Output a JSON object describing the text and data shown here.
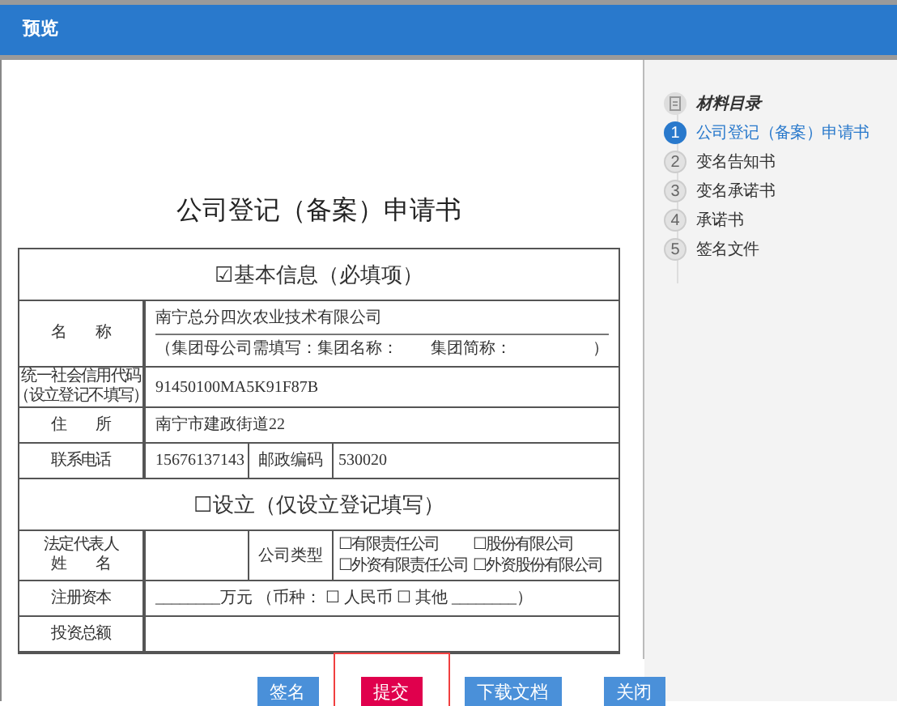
{
  "header": {
    "title": "预览"
  },
  "document": {
    "title": "公司登记（备案）申请书",
    "sections": [
      {
        "heading": "☑基本信息（必填项）",
        "rows": [
          {
            "kind": "name",
            "label": "名　　称",
            "value": "南宁总分四次农业技术有限公司",
            "note": "（集团母公司需填写：集团名称：",
            "note_2": "集团简称：",
            "note_end": "）"
          },
          {
            "kind": "wide",
            "label_lines": [
              "统一社会信用代码",
              "（设立登记不填写）"
            ],
            "value": "91450100MA5K91F87B"
          },
          {
            "kind": "wide",
            "label": "住　　所",
            "value": "南宁市建政街道22"
          },
          {
            "kind": "split",
            "label": "联系电话",
            "value": "15676137143",
            "label_2": "邮政编码",
            "value_2": "530020"
          }
        ]
      },
      {
        "heading": "☐设立（仅设立登记填写）",
        "rows": [
          {
            "kind": "options",
            "label_lines": [
              "法定代表人",
              "姓　　名"
            ],
            "value": "",
            "label_2": "公司类型",
            "options": [
              "☐有限责任公司",
              "☐股份有限公司",
              "☐外资有限责任公司",
              "☐外资股份有限公司"
            ]
          },
          {
            "kind": "wide",
            "label": "注册资本",
            "value": "________万元 （币种： ☐ 人民币 ☐ 其他 ________）"
          },
          {
            "kind": "wide",
            "label": "投资总额",
            "value": ""
          }
        ]
      }
    ]
  },
  "sidebar": {
    "title": "材料目录",
    "items": [
      {
        "number": "1",
        "label": "公司登记（备案）申请书",
        "selected": true
      },
      {
        "number": "2",
        "label": "变名告知书",
        "selected": false
      },
      {
        "number": "3",
        "label": "变名承诺书",
        "selected": false
      },
      {
        "number": "4",
        "label": "承诺书",
        "selected": false
      },
      {
        "number": "5",
        "label": "签名文件",
        "selected": false
      }
    ]
  },
  "buttons": [
    {
      "label": "签名",
      "kind": "primary",
      "highlighted": false
    },
    {
      "label": "提交",
      "kind": "danger",
      "highlighted": true
    },
    {
      "label": "下载文档",
      "kind": "primary",
      "highlighted": false
    },
    {
      "label": "关闭",
      "kind": "primary",
      "highlighted": false
    }
  ]
}
